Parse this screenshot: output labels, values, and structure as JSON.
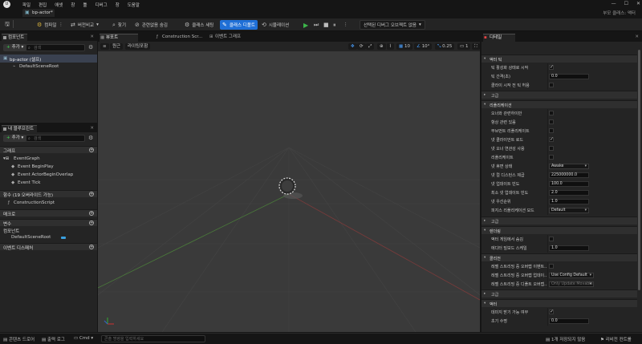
{
  "menu": [
    "파일",
    "편집",
    "애셋",
    "창",
    "툴",
    "디버그",
    "창",
    "도움말"
  ],
  "window_controls": [
    "—",
    "☐",
    "✕"
  ],
  "project_name": "부모 클래스: 액터",
  "doc_tab": "bp-actor*",
  "toolbar": {
    "save_label": "",
    "compile_label": "컴파일",
    "diff_label": "버전비교",
    "find_label": "찾기",
    "hide_unrelated_label": "관련없음 숨김",
    "class_settings_label": "클래스 세팅",
    "class_defaults_label": "클래스 디폴트",
    "simulation_label": "시뮬레이션",
    "debug_object_label": "선택된 디버그 오브젝트 없음"
  },
  "components_panel": {
    "tab": "컴포넌트",
    "add_label": "추가",
    "search_placeholder": "검색",
    "root_item": "bp-actor (셀프)",
    "child_item": "DefaultSceneRoot"
  },
  "blueprint_panel": {
    "tab": "내 블루프린트",
    "add_label": "추가",
    "search_placeholder": "검색",
    "sections": {
      "graphs": "그래프",
      "functions": "함수 (19 오버라이드 가능)",
      "macros": "매크로",
      "variables": "변수",
      "components": "컴포넌트",
      "dispatchers": "이벤트 디스패처"
    },
    "event_graph": "EventGraph",
    "events": [
      "Event BeginPlay",
      "Event ActorBeginOverlap",
      "Event Tick"
    ],
    "construction_script": "ConstructionScript",
    "component_var": "DefaultSceneRoot"
  },
  "viewport_tabs": [
    "뷰포트",
    "Construction Scr...",
    "이벤트 그래프"
  ],
  "viewport_bar": {
    "perspective": "원근",
    "lit": "라이팅포함",
    "grid_snap": "10",
    "rot_snap": "10°",
    "scale_snap": "0.25",
    "camera_speed": "1"
  },
  "details": {
    "tab": "디테일",
    "sections": {
      "tick": "액터 틱",
      "advanced1": "고급",
      "replication": "리플리케이션",
      "advanced2": "고급",
      "rendering": "렌더링",
      "collision": "콜리전",
      "advanced3": "고급",
      "actor": "액터"
    },
    "tick_rows": [
      {
        "label": "틱 활성화 상태로 시작",
        "type": "check",
        "on": true
      },
      {
        "label": "틱 간격(초)",
        "type": "value",
        "value": "0.0"
      },
      {
        "label": "클라이 시작 전 틱 허용",
        "type": "check",
        "on": false
      }
    ],
    "replication_rows": [
      {
        "label": "오너와 관련하이만",
        "type": "check",
        "on": false
      },
      {
        "label": "항상 관련 있음",
        "type": "check",
        "on": false
      },
      {
        "label": "무브먼트 리플리케이트",
        "type": "check",
        "on": false
      },
      {
        "label": "넷 클라이언트 로드",
        "type": "check",
        "on": true
      },
      {
        "label": "넷 오너 연관성 사용",
        "type": "check",
        "on": false
      },
      {
        "label": "리플리케이트",
        "type": "check",
        "on": false
      },
      {
        "label": "넷 휴면 상태",
        "type": "select",
        "value": "Awake"
      },
      {
        "label": "넷 컬 디스턴스 제곱",
        "type": "value",
        "value": "225000000.0"
      },
      {
        "label": "넷 업데이트 빈도",
        "type": "value",
        "value": "100.0"
      },
      {
        "label": "최소 넷 업데이트 빈도",
        "type": "value",
        "value": "2.0"
      },
      {
        "label": "넷 우선순위",
        "type": "value",
        "value": "1.0"
      },
      {
        "label": "피지스 리플리케이션 모드",
        "type": "select",
        "value": "Default"
      }
    ],
    "rendering_rows": [
      {
        "label": "액터 게임에서 숨김",
        "type": "check",
        "on": false
      },
      {
        "label": "에디터 빌보드 스케일",
        "type": "value",
        "value": "1.0"
      }
    ],
    "collision_rows": [
      {
        "label": "레벨 스트리밍 중 오버랩 이벤트...",
        "type": "check",
        "on": false
      },
      {
        "label": "레벨 스트리밍 중 오버랩 업데이...",
        "type": "select",
        "value": "Use Config Default"
      },
      {
        "label": "레벨 스트리밍 중 디폴트 오버랩...",
        "type": "select",
        "value": "Only Update Movable",
        "dim": true
      }
    ],
    "actor_rows": [
      {
        "label": "데미지 받기 가능 여부",
        "type": "check",
        "on": true
      },
      {
        "label": "초기 수명",
        "type": "value",
        "value": "0.0"
      }
    ]
  },
  "statusbar": {
    "content_drawer": "콘텐츠 드로어",
    "output_log": "출력 로그",
    "cmd": "Cmd",
    "console_placeholder": "콘솔 명령을 입력하세요",
    "unsaved": "1개 저장되지 않음",
    "source_control": "리비전 컨트롤"
  },
  "colors": {
    "accent_blue": "#1f6fd6",
    "play_green": "#3cb54a",
    "panel_bg": "#242424",
    "viewport_bg": "#3a3a3a"
  }
}
